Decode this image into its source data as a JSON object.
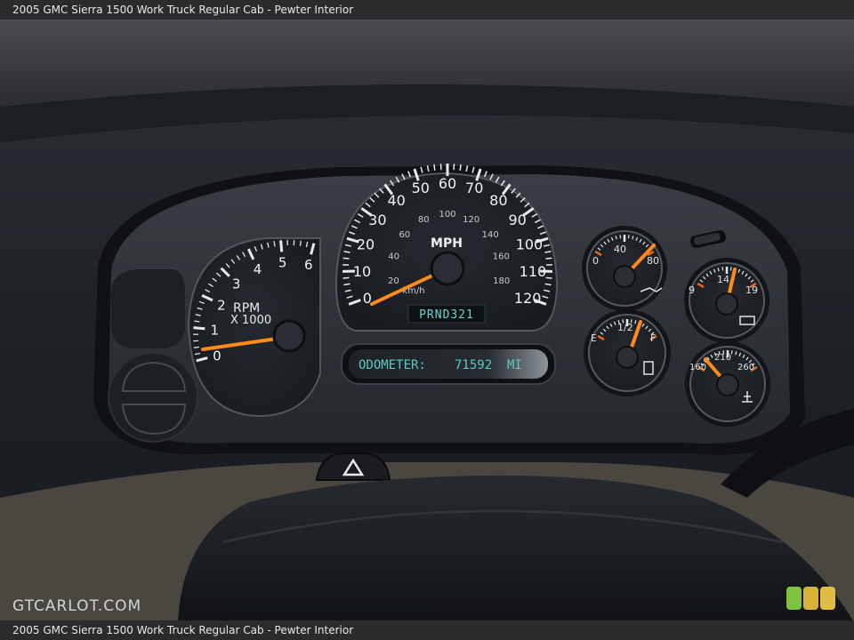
{
  "caption": "2005 GMC Sierra 1500 Work Truck Regular Cab - Pewter Interior",
  "watermark": "GTCARLOT.COM",
  "badge_colors": [
    "#7fc241",
    "#d9b23a",
    "#e0bd45"
  ],
  "speedometer": {
    "unit_label": "MPH",
    "metric_unit_label": "km/h",
    "mph_ticks": [
      "0",
      "10",
      "20",
      "30",
      "40",
      "50",
      "60",
      "70",
      "80",
      "90",
      "100",
      "110",
      "120"
    ],
    "kmh_ticks": [
      "20",
      "40",
      "60",
      "80",
      "100",
      "120",
      "140",
      "160",
      "180"
    ],
    "needle_value": 0
  },
  "tachometer": {
    "label_line1": "RPM",
    "label_line2": "X 1000",
    "ticks": [
      "0",
      "1",
      "2",
      "3",
      "4",
      "5",
      "6"
    ],
    "needle_value": 0.7
  },
  "gear_display": "PRND321",
  "odometer": {
    "label": "ODOMETER:",
    "value": "71592",
    "unit": "MI"
  },
  "oil_gauge": {
    "ticks": [
      "0",
      "40",
      "80"
    ],
    "icon": "oil-can-icon"
  },
  "volt_gauge": {
    "ticks": [
      "9",
      "14",
      "19"
    ],
    "icon": "battery-icon"
  },
  "fuel_gauge": {
    "ticks": [
      "E",
      "1/2",
      "F"
    ],
    "icon": "fuel-pump-icon"
  },
  "temp_gauge": {
    "ticks": [
      "160",
      "210",
      "260"
    ],
    "icon": "coolant-temp-icon"
  }
}
